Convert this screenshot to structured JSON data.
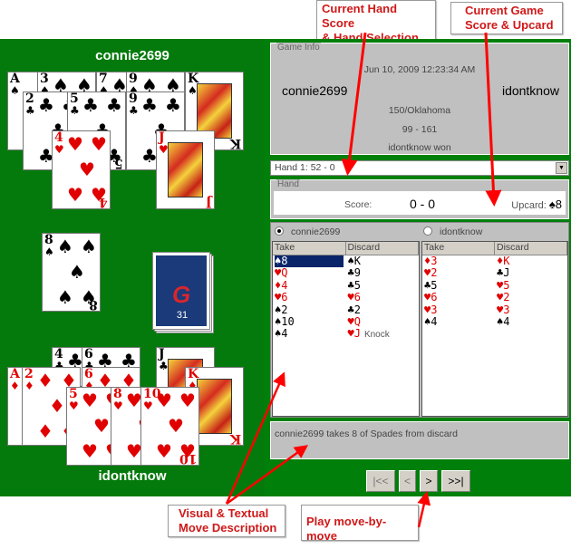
{
  "table": {
    "top_player": "connie2699",
    "bottom_player": "idontknow",
    "top_hand": [
      {
        "rank": "A",
        "suit": "♠",
        "color": "black"
      },
      {
        "rank": "3",
        "suit": "♠",
        "color": "black"
      },
      {
        "rank": "7",
        "suit": "♠",
        "color": "black"
      },
      {
        "rank": "9",
        "suit": "♠",
        "color": "black"
      },
      {
        "rank": "K",
        "suit": "♠",
        "color": "black"
      },
      {
        "rank": "2",
        "suit": "♣",
        "color": "black"
      },
      {
        "rank": "5",
        "suit": "♣",
        "color": "black"
      },
      {
        "rank": "9",
        "suit": "♣",
        "color": "black"
      },
      {
        "rank": "4",
        "suit": "♥",
        "color": "red"
      },
      {
        "rank": "J",
        "suit": "♥",
        "color": "red"
      }
    ],
    "discard_card": {
      "rank": "8",
      "suit": "♠",
      "color": "black"
    },
    "deck_count": "31",
    "deck_logo": "G",
    "bottom_hand": [
      {
        "rank": "4",
        "suit": "♣",
        "color": "black"
      },
      {
        "rank": "6",
        "suit": "♣",
        "color": "black"
      },
      {
        "rank": "J",
        "suit": "♣",
        "color": "black"
      },
      {
        "rank": "A",
        "suit": "♦",
        "color": "red"
      },
      {
        "rank": "2",
        "suit": "♦",
        "color": "red"
      },
      {
        "rank": "6",
        "suit": "♦",
        "color": "red"
      },
      {
        "rank": "K",
        "suit": "♦",
        "color": "red"
      },
      {
        "rank": "5",
        "suit": "♥",
        "color": "red"
      },
      {
        "rank": "8",
        "suit": "♥",
        "color": "red"
      },
      {
        "rank": "10",
        "suit": "♥",
        "color": "red"
      }
    ]
  },
  "game_info": {
    "legend": "Game Info",
    "date": "Jun 10, 2009 12:23:34 AM",
    "player1": "connie2699",
    "player2": "idontknow",
    "game_type": "150/Oklahoma",
    "final_score": "99 - 161",
    "result": "idontknow won"
  },
  "hand_select": {
    "value": "Hand 1: 52 - 0",
    "arrow": "▼"
  },
  "hand": {
    "legend": "Hand",
    "score_label": "Score:",
    "score": "0 - 0",
    "upcard_label": "Upcard:",
    "upcard": "♠8"
  },
  "moves": {
    "player1": {
      "name": "connie2699",
      "selected": true,
      "headers": [
        "Take",
        "Discard"
      ],
      "take": [
        {
          "text": "♠8",
          "color": "black",
          "selected": true
        },
        {
          "text": "♥Q",
          "color": "red"
        },
        {
          "text": "♦4",
          "color": "red"
        },
        {
          "text": "♥6",
          "color": "red"
        },
        {
          "text": "♠2",
          "color": "black"
        },
        {
          "text": "♠10",
          "color": "black"
        },
        {
          "text": "♠4",
          "color": "black"
        }
      ],
      "discard": [
        {
          "text": "♠K",
          "color": "black"
        },
        {
          "text": "♣9",
          "color": "black"
        },
        {
          "text": "♣5",
          "color": "black"
        },
        {
          "text": "♥6",
          "color": "red"
        },
        {
          "text": "♣2",
          "color": "black"
        },
        {
          "text": "♥Q",
          "color": "red"
        },
        {
          "text": "♥J",
          "color": "red",
          "note": "Knock"
        }
      ]
    },
    "player2": {
      "name": "idontknow",
      "selected": false,
      "headers": [
        "Take",
        "Discard"
      ],
      "take": [
        {
          "text": "♦3",
          "color": "red"
        },
        {
          "text": "♥2",
          "color": "red"
        },
        {
          "text": "♣5",
          "color": "black"
        },
        {
          "text": "♥6",
          "color": "red"
        },
        {
          "text": "♥3",
          "color": "red"
        },
        {
          "text": "♠4",
          "color": "black"
        }
      ],
      "discard": [
        {
          "text": "♦K",
          "color": "red"
        },
        {
          "text": "♣J",
          "color": "black"
        },
        {
          "text": "♥5",
          "color": "red"
        },
        {
          "text": "♥2",
          "color": "red"
        },
        {
          "text": "♥3",
          "color": "red"
        },
        {
          "text": "♠4",
          "color": "black"
        }
      ]
    }
  },
  "description": "connie2699 takes 8 of Spades from discard",
  "nav": {
    "first": "|<<",
    "prev": "<",
    "next": ">",
    "last": ">>|"
  },
  "callouts": {
    "hand_score": [
      "Current Hand Score",
      "& Hand Selection"
    ],
    "game_score": [
      "Current Game",
      "Score & Upcard"
    ],
    "visual": [
      "Visual & Textual",
      "Move Description"
    ],
    "play": "Play move-by-move"
  },
  "colors": {
    "table_green": "#047a0c",
    "red": "#e00000",
    "selection": "#0a246a",
    "callout_red": "#d01818"
  }
}
